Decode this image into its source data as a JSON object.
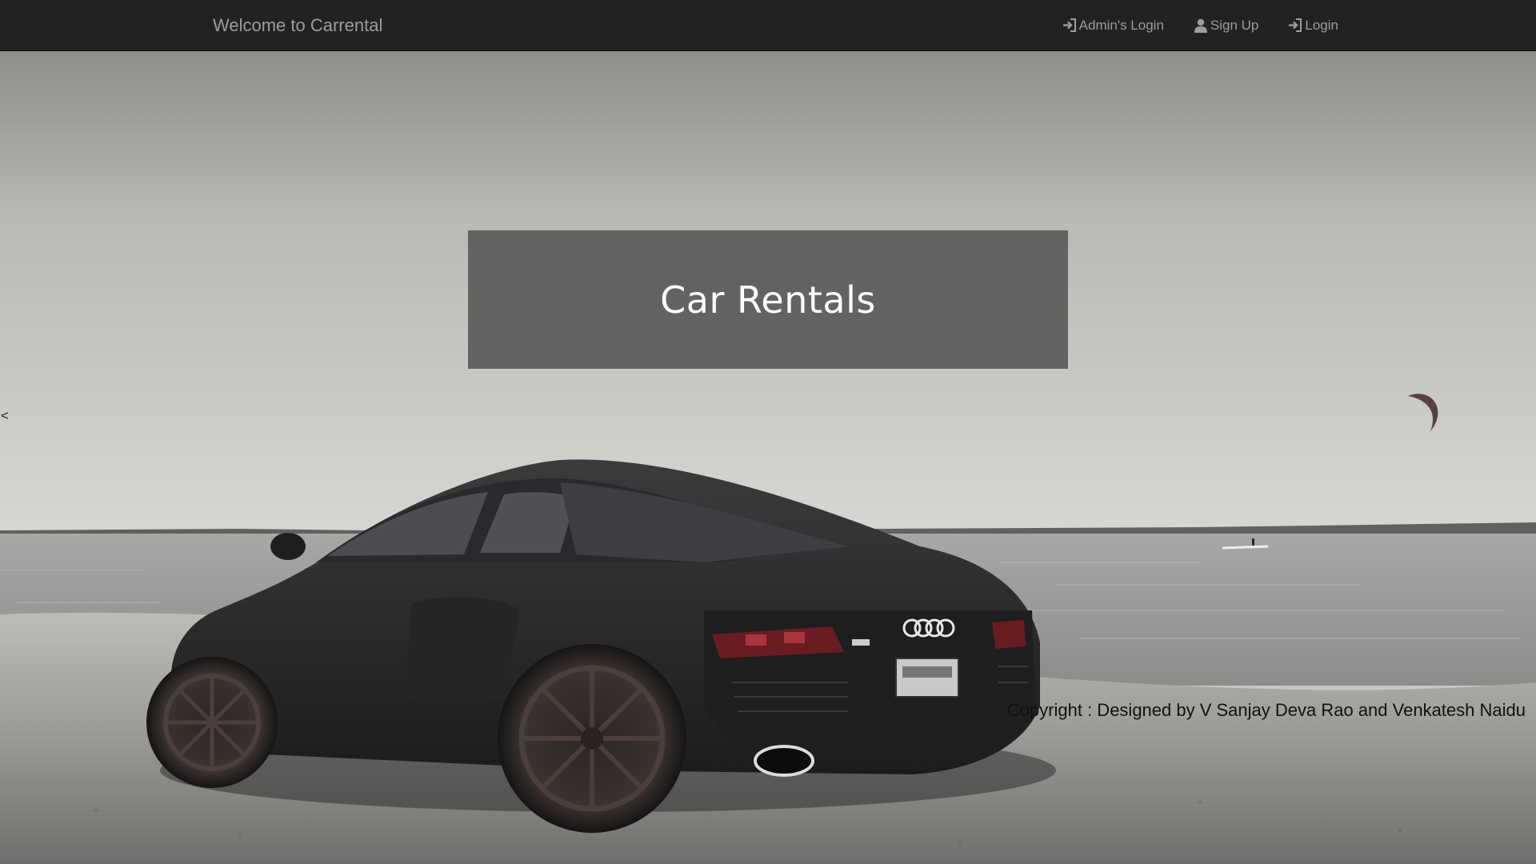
{
  "navbar": {
    "brand": "Welcome to Carrental",
    "links": [
      {
        "label": "Admin's Login",
        "icon": "log-in-icon"
      },
      {
        "label": "Sign Up",
        "icon": "user-icon"
      },
      {
        "label": "Login",
        "icon": "log-in-icon"
      }
    ]
  },
  "hero": {
    "title": "Car Rentals",
    "prev_arrow": "<"
  },
  "footer": {
    "copyright": "Copyright : Designed by V Sanjay Deva Rao and Venkatesh Naidu"
  },
  "colors": {
    "navbar_bg": "#222222",
    "nav_text": "#9d9d9d",
    "title_box_bg": "#555555",
    "title_text": "#ffffff"
  }
}
